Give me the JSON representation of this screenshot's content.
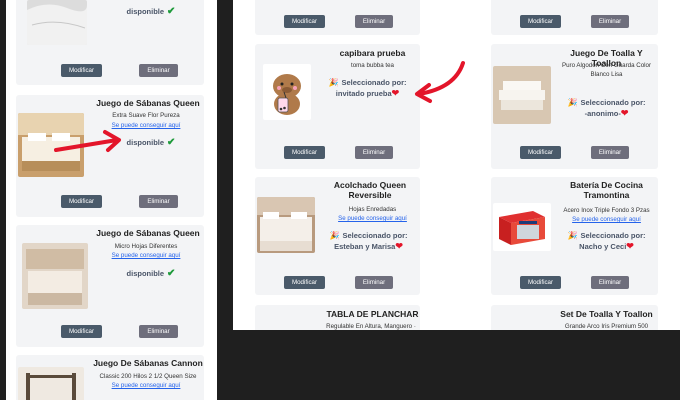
{
  "buttons": {
    "modify": "Modificar",
    "delete": "Eliminar"
  },
  "status": {
    "available": "disponible"
  },
  "link_text": "Se puede conseguir aquí",
  "selected_prefix": "Seleccionado por:",
  "left_cards": [
    {
      "title": "",
      "desc": "",
      "status": "disponible"
    },
    {
      "title": "Juego de Sábanas Queen",
      "desc": "Extra Suave Flor Pureza",
      "link": "Se puede conseguir aquí",
      "status": "disponible"
    },
    {
      "title": "Juego de Sábanas Queen",
      "desc": "Micro Hojas Diferentes",
      "link": "Se puede conseguir aquí",
      "status": "disponible"
    },
    {
      "title": "Juego De Sábanas Cannon",
      "desc": "Classic 200 Hilos 2 1/2 Queen Size",
      "link": "Se puede conseguir aquí"
    }
  ],
  "right_cards": [
    {
      "title": "capibara prueba",
      "desc": "toma bubba tea",
      "selected_label": "Seleccionado por:",
      "selected_by": "invitado prueba"
    },
    {
      "title": "Juego De Toalla Y Toallon",
      "desc": "Puro Algodon Con Guarda Color Blanco Lisa",
      "selected_label": "Seleccionado por:",
      "selected_by": "-anonimo-"
    },
    {
      "title": "Acolchado Queen Reversible",
      "desc": "Hojas Enredadas",
      "link": "Se puede conseguir aquí",
      "selected_label": "Seleccionado por:",
      "selected_by": "Esteban y Marisa"
    },
    {
      "title": "Batería De Cocina Tramontina",
      "desc": "Acero Inox Triple Fondo 3 Pzas",
      "link": "Se puede conseguir aquí",
      "selected_label": "Seleccionado por:",
      "selected_by": "Nacho y Ceci"
    },
    {
      "title": "TABLA DE PLANCHAR",
      "desc": "Regulable En Altura, Manguero ·"
    },
    {
      "title": "Set De Toalla Y Toallon",
      "desc": "Grande Arco Iris Premium 500"
    }
  ],
  "colors": {
    "card_bg": "#f3f4f6",
    "modify_btn": "#4a5a6a",
    "delete_btn": "#6e6e7c",
    "link": "#2563eb",
    "check": "#1d9a3a",
    "heart": "#e3152a",
    "arrow": "#e3152a"
  }
}
